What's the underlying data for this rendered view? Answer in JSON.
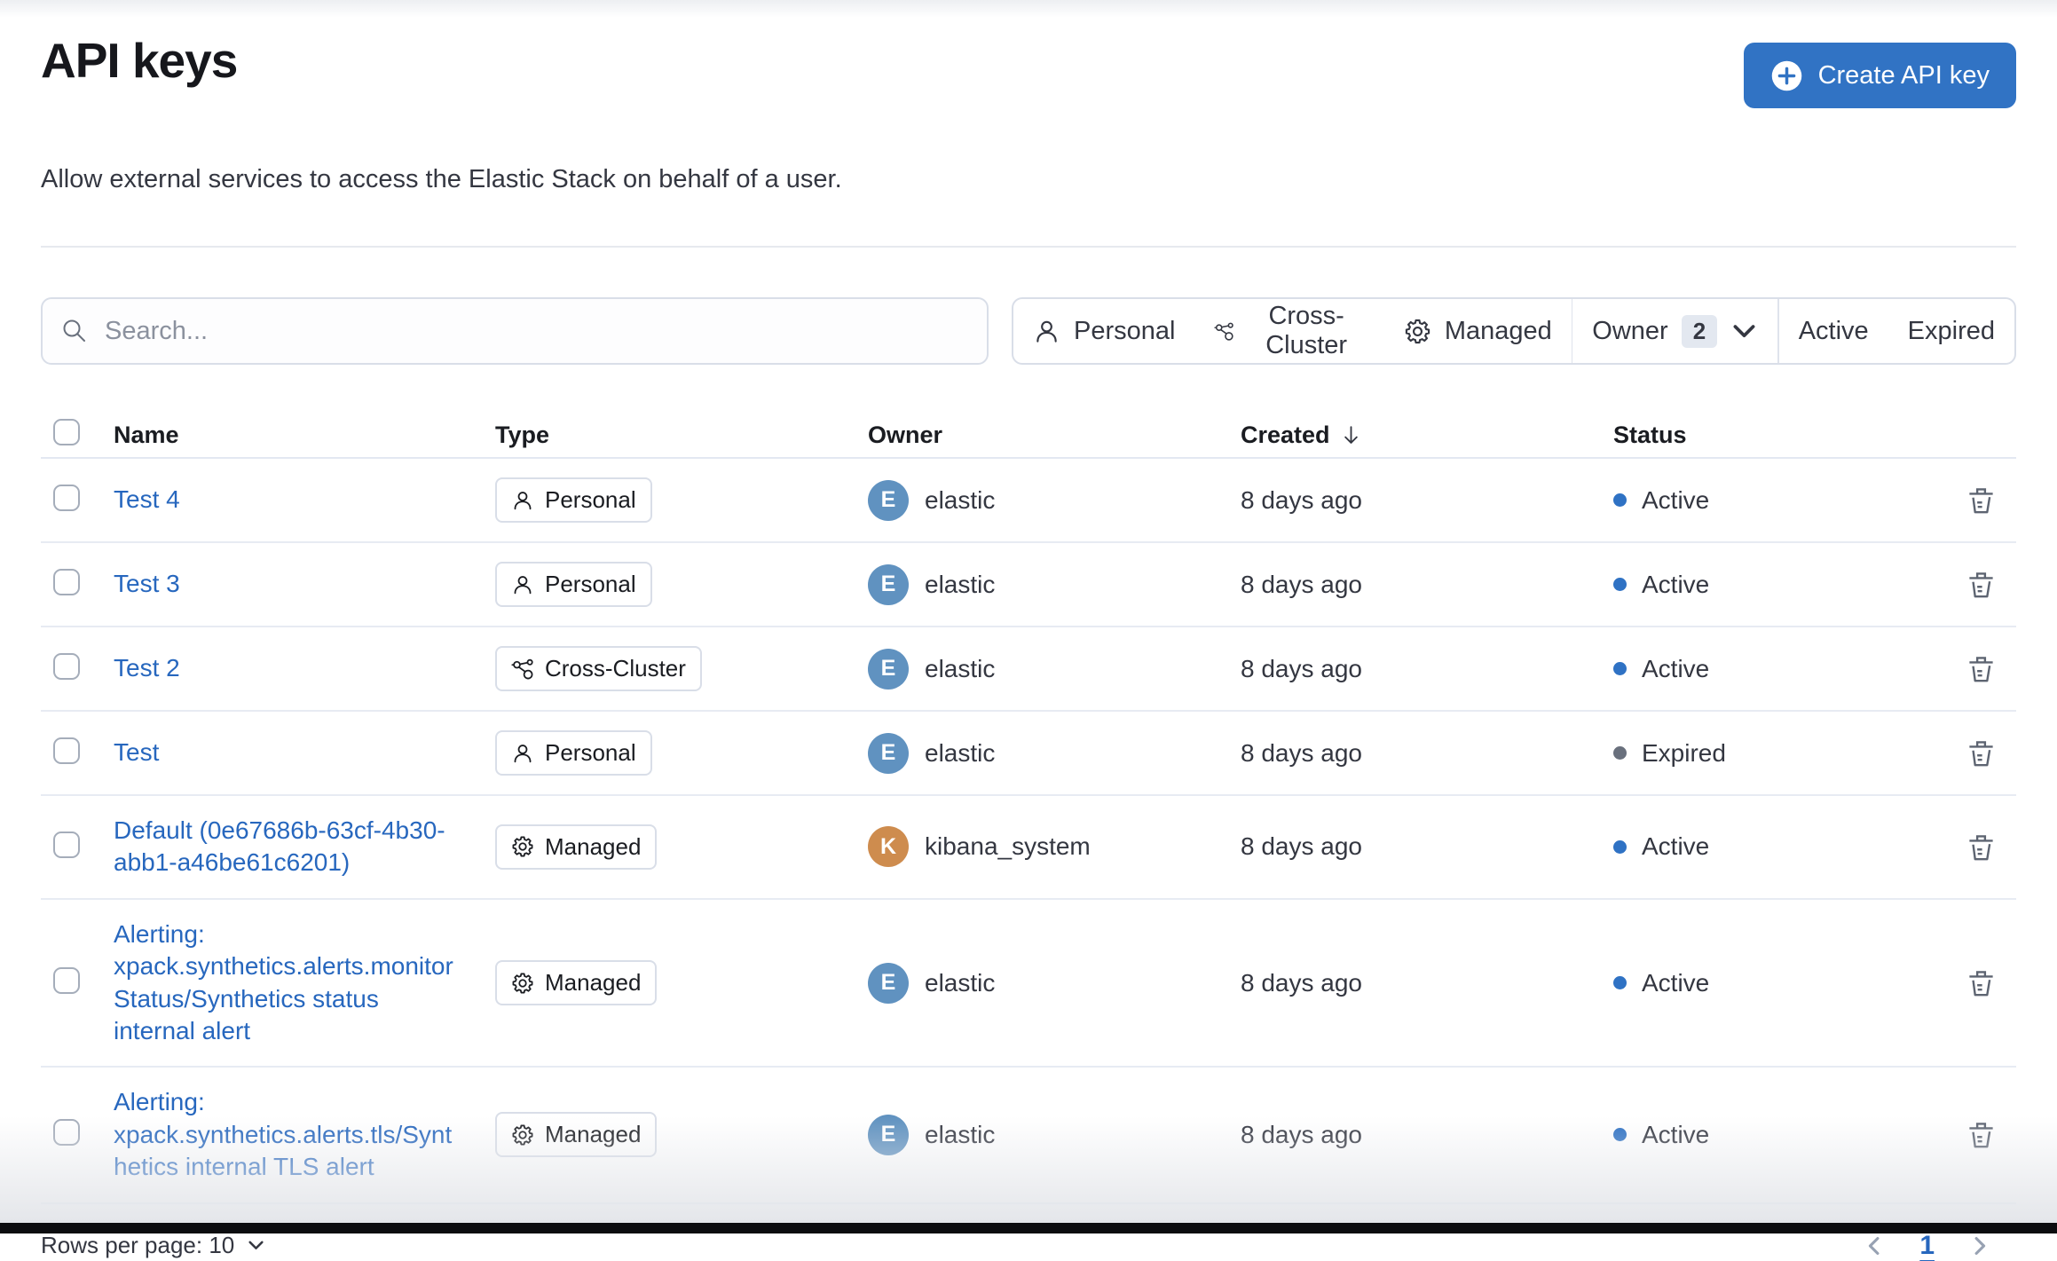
{
  "page": {
    "title": "API keys",
    "subtitle": "Allow external services to access the Elastic Stack on behalf of a user.",
    "create_button_label": "Create API key"
  },
  "toolbar": {
    "search_placeholder": "Search...",
    "type_filters": [
      {
        "label": "Personal",
        "icon": "user-icon"
      },
      {
        "label": "Cross-Cluster",
        "icon": "cluster-icon"
      },
      {
        "label": "Managed",
        "icon": "gear-icon"
      }
    ],
    "owner_filter": {
      "label": "Owner",
      "count": "2",
      "icon": "chevron-down-icon"
    },
    "status_filters": [
      {
        "label": "Active"
      },
      {
        "label": "Expired"
      }
    ]
  },
  "table": {
    "headers": {
      "name": "Name",
      "type": "Type",
      "owner": "Owner",
      "created": "Created",
      "status": "Status"
    },
    "sort": {
      "column": "Created",
      "direction": "descending",
      "icon": "arrow-down-icon"
    },
    "rows": [
      {
        "name": "Test 4",
        "type": "Personal",
        "type_icon": "user-icon",
        "owner": "elastic",
        "owner_initial": "E",
        "created": "8 days ago",
        "status": "Active"
      },
      {
        "name": "Test 3",
        "type": "Personal",
        "type_icon": "user-icon",
        "owner": "elastic",
        "owner_initial": "E",
        "created": "8 days ago",
        "status": "Active"
      },
      {
        "name": "Test 2",
        "type": "Cross-Cluster",
        "type_icon": "cluster-icon",
        "owner": "elastic",
        "owner_initial": "E",
        "created": "8 days ago",
        "status": "Active"
      },
      {
        "name": "Test",
        "type": "Personal",
        "type_icon": "user-icon",
        "owner": "elastic",
        "owner_initial": "E",
        "created": "8 days ago",
        "status": "Expired"
      },
      {
        "name": "Default (0e67686b-63cf-4b30-abb1-a46be61c6201)",
        "type": "Managed",
        "type_icon": "gear-icon",
        "owner": "kibana_system",
        "owner_initial": "K",
        "created": "8 days ago",
        "status": "Active"
      },
      {
        "name": "Alerting: xpack.synthetics.alerts.monitorStatus/Synthetics status internal alert",
        "type": "Managed",
        "type_icon": "gear-icon",
        "owner": "elastic",
        "owner_initial": "E",
        "created": "8 days ago",
        "status": "Active"
      },
      {
        "name": "Alerting: xpack.synthetics.alerts.tls/Synthetics internal TLS alert",
        "type": "Managed",
        "type_icon": "gear-icon",
        "owner": "elastic",
        "owner_initial": "E",
        "created": "8 days ago",
        "status": "Active"
      }
    ],
    "row_actions": [
      {
        "label": "Delete",
        "icon": "trash-icon"
      }
    ]
  },
  "pagination": {
    "rows_per_page_label": "Rows per page: 10",
    "current_page": "1"
  },
  "colors": {
    "primary_button": "#3173c4",
    "link": "#2767be",
    "status_active_dot": "#2f72c4",
    "status_expired_dot": "#69707d",
    "avatar_elastic": "#6092c0",
    "avatar_kibana_system": "#ce8c4e",
    "border": "#d9dee8",
    "row_separator": "#e7ebf3",
    "text": "#343741"
  }
}
